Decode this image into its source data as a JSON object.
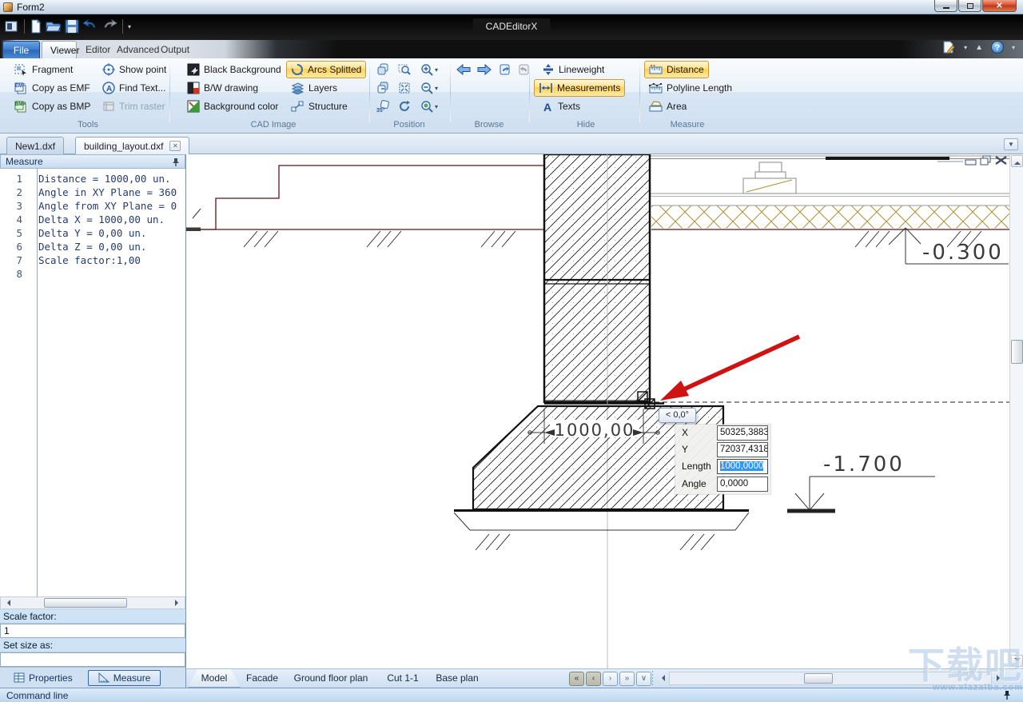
{
  "window": {
    "title": "Form2",
    "app_name": "CADEditorX"
  },
  "ribbon_tabs": {
    "file": "File",
    "viewer": "Viewer",
    "editor": "Editor",
    "advanced": "Advanced",
    "output": "Output"
  },
  "ribbon": {
    "tools": {
      "label": "Tools",
      "fragment": "Fragment",
      "copy_emf": "Copy as EMF",
      "copy_bmp": "Copy as BMP",
      "show_point": "Show point",
      "find_text": "Find Text...",
      "trim_raster": "Trim raster",
      "emf_icon_text": "EMF",
      "bmp_icon_text": "BMP"
    },
    "cad_image": {
      "label": "CAD Image",
      "black_bg": "Black Background",
      "bw": "B/W drawing",
      "bg_color": "Background color",
      "arcs": "Arcs Splitted",
      "layers": "Layers",
      "structure": "Structure"
    },
    "position": {
      "label": "Position",
      "rotate_icon_text": "35°"
    },
    "browse": {
      "label": "Browse"
    },
    "hide": {
      "label": "Hide",
      "lineweight": "Lineweight",
      "measurements": "Measurements",
      "texts": "Texts",
      "texts_icon": "A"
    },
    "measure": {
      "label": "Measure",
      "distance": "Distance",
      "polyline": "Polyline Length",
      "area": "Area"
    }
  },
  "document_tabs": {
    "tab1": "New1.dxf",
    "tab2": "building_layout.dxf"
  },
  "measure_panel": {
    "title": "Measure",
    "lines": [
      {
        "n": "1",
        "text": "Distance = 1000,00 un."
      },
      {
        "n": "2",
        "text": "Angle in XY Plane = 360"
      },
      {
        "n": "3",
        "text": "Angle from XY Plane = 0"
      },
      {
        "n": "4",
        "text": "Delta X = 1000,00 un."
      },
      {
        "n": "5",
        "text": "Delta Y = 0,00 un."
      },
      {
        "n": "6",
        "text": "Delta Z = 0,00 un."
      },
      {
        "n": "7",
        "text": "Scale factor:1,00"
      },
      {
        "n": "8",
        "text": ""
      }
    ],
    "scale_factor_label": "Scale factor:",
    "scale_factor_value": "1",
    "set_size_label": "Set size as:",
    "tab_properties": "Properties",
    "tab_measure": "Measure"
  },
  "drawing": {
    "dimension": "1000,00",
    "elevation_upper": "-0.300",
    "elevation_lower": "-1.700",
    "angle_tooltip": "< 0,0°",
    "coords": {
      "x_label": "X",
      "x_value": "50325,3883",
      "y_label": "Y",
      "y_value": "72037,4318",
      "length_label": "Length",
      "length_value": "1000,0000",
      "angle_label": "Angle",
      "angle_value": "0,0000"
    }
  },
  "layout_tabs": {
    "model": "Model",
    "facade": "Facade",
    "ground": "Ground floor plan",
    "cut": "Cut 1-1",
    "base": "Base plan"
  },
  "nav_icons": {
    "first": "«",
    "prev": "‹",
    "next": "›",
    "last": "»",
    "list": "∨"
  },
  "status_bar": "Command line",
  "watermark": {
    "text": "下载吧",
    "url": "www.xiazaiba.com"
  },
  "colors": {
    "ribbon_highlight": "#FFD75E",
    "selection_blue": "#2F97FB",
    "arrow_red": "#CF1212",
    "insulation_hatch": "#AB9136",
    "ground_line": "#5C1616"
  }
}
